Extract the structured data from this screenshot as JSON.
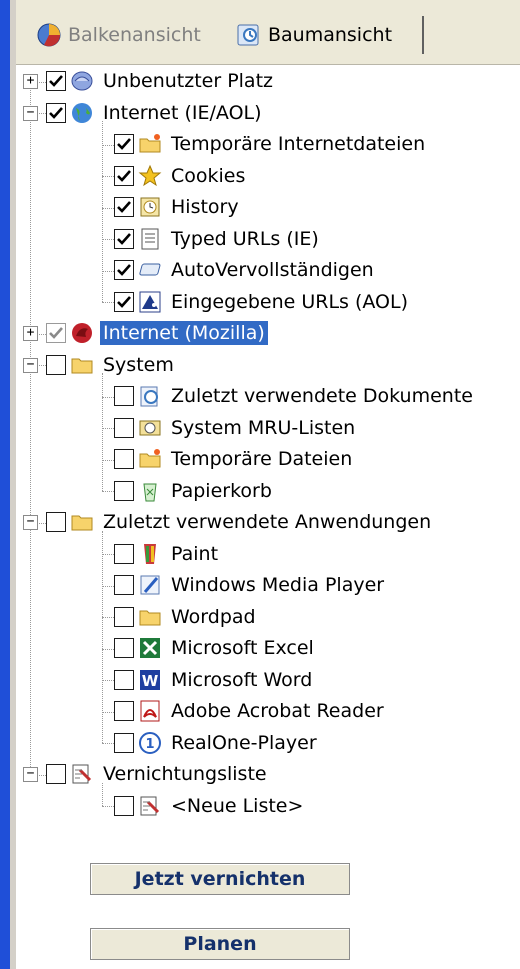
{
  "tabs": [
    {
      "label": "Balkenansicht",
      "icon": "pie-chart-icon",
      "active": false
    },
    {
      "label": "Baumansicht",
      "icon": "tree-view-icon",
      "active": true
    }
  ],
  "tree": [
    {
      "label": "Unbenutzter Platz",
      "icon": "disk-space-icon",
      "checked": true,
      "level": 0,
      "expander": "+"
    },
    {
      "label": "Internet (IE/AOL)",
      "icon": "internet-globe-icon",
      "checked": true,
      "level": 0,
      "expander": "-"
    },
    {
      "label": "Temporäre Internetdateien",
      "icon": "temp-folder-icon",
      "checked": true,
      "level": 1
    },
    {
      "label": "Cookies",
      "icon": "cookie-star-icon",
      "checked": true,
      "level": 1
    },
    {
      "label": "History",
      "icon": "history-icon",
      "checked": true,
      "level": 1
    },
    {
      "label": "Typed URLs (IE)",
      "icon": "document-icon",
      "checked": true,
      "level": 1
    },
    {
      "label": "AutoVervollständigen",
      "icon": "autocomplete-icon",
      "checked": true,
      "level": 1
    },
    {
      "label": "Eingegebene URLs (AOL)",
      "icon": "aol-icon",
      "checked": true,
      "level": 1
    },
    {
      "label": "Internet (Mozilla)",
      "icon": "mozilla-icon",
      "checked": "gray",
      "level": 0,
      "expander": "+",
      "selected": true
    },
    {
      "label": "System",
      "icon": "folder-icon",
      "checked": false,
      "level": 0,
      "expander": "-"
    },
    {
      "label": "Zuletzt verwendete Dokumente",
      "icon": "recent-docs-icon",
      "checked": false,
      "level": 1
    },
    {
      "label": "System MRU-Listen",
      "icon": "mru-list-icon",
      "checked": false,
      "level": 1
    },
    {
      "label": "Temporäre Dateien",
      "icon": "temp-folder-icon",
      "checked": false,
      "level": 1
    },
    {
      "label": "Papierkorb",
      "icon": "recycle-bin-icon",
      "checked": false,
      "level": 1
    },
    {
      "label": "Zuletzt verwendete Anwendungen",
      "icon": "folder-icon",
      "checked": false,
      "level": 0,
      "expander": "-"
    },
    {
      "label": "Paint",
      "icon": "paint-icon",
      "checked": false,
      "level": 1
    },
    {
      "label": "Windows Media Player",
      "icon": "media-player-icon",
      "checked": false,
      "level": 1
    },
    {
      "label": "Wordpad",
      "icon": "folder-icon",
      "checked": false,
      "level": 1
    },
    {
      "label": "Microsoft Excel",
      "icon": "excel-icon",
      "checked": false,
      "level": 1
    },
    {
      "label": "Microsoft Word",
      "icon": "word-icon",
      "checked": false,
      "level": 1
    },
    {
      "label": "Adobe Acrobat Reader",
      "icon": "acrobat-icon",
      "checked": false,
      "level": 1
    },
    {
      "label": "RealOne-Player",
      "icon": "realone-icon",
      "checked": false,
      "level": 1
    },
    {
      "label": "Vernichtungsliste",
      "icon": "shred-list-icon",
      "checked": false,
      "level": 0,
      "expander": "-"
    },
    {
      "label": "<Neue Liste>",
      "icon": "shred-list-icon",
      "checked": false,
      "level": 1
    }
  ],
  "buttons": {
    "shred": "Jetzt vernichten",
    "plan": "Planen"
  }
}
